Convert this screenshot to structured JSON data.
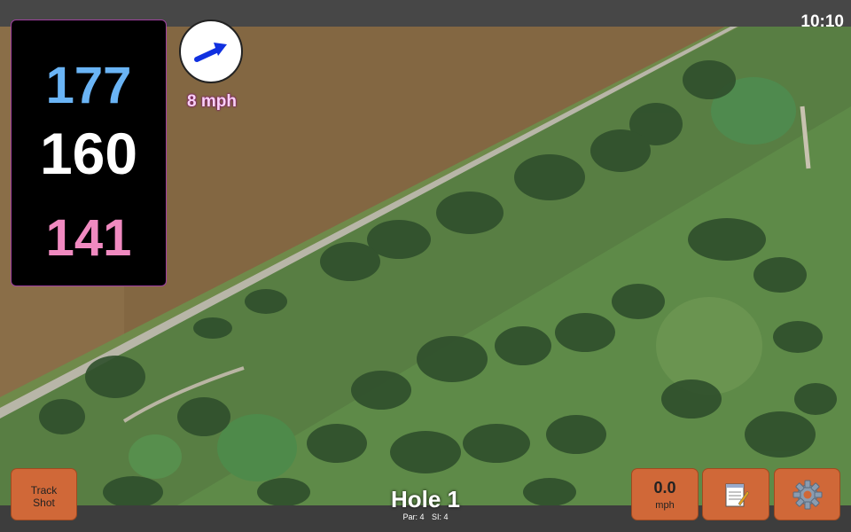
{
  "status_bar": {
    "time": "10:10"
  },
  "distances": {
    "back": "177",
    "middle": "160",
    "front": "141"
  },
  "wind": {
    "speed_text": "8 mph",
    "direction_icon": "wind-arrow-icon"
  },
  "buttons": {
    "track_shot_line1": "Track",
    "track_shot_line2": "Shot",
    "wind_value": "0.0",
    "wind_unit": "mph",
    "notes_icon": "notepad-icon",
    "settings_icon": "gear-icon"
  },
  "hole": {
    "title": "Hole 1",
    "par": "Par: 4",
    "si": "SI: 4"
  },
  "colors": {
    "back_distance": "#6ab4f5",
    "middle_distance": "#ffffff",
    "front_distance": "#f08ac0",
    "button": "#d06838",
    "panel_border": "#a040a0"
  }
}
